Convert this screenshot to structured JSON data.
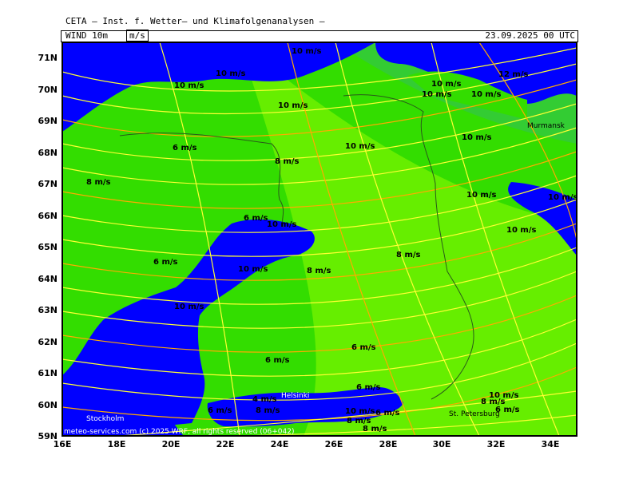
{
  "header": {
    "title": "CETA — Inst. f. Wetter— und Klimafolgenanalysen —",
    "parameter": "WIND  10m",
    "unit": "m/s",
    "valid_time": "23.09.2025  00 UTC"
  },
  "map": {
    "lat_ticks": [
      "71N",
      "70N",
      "69N",
      "68N",
      "67N",
      "66N",
      "65N",
      "64N",
      "63N",
      "62N",
      "61N",
      "60N",
      "59N"
    ],
    "lon_ticks": [
      "16E",
      "18E",
      "20E",
      "22E",
      "24E",
      "26E",
      "28E",
      "30E",
      "32E",
      "34E"
    ],
    "colors": {
      "sea": "#0000ff",
      "wind_6_8": "#00dd00",
      "wind_8_10": "#55ee00",
      "wind_10_plus": "#33cc33",
      "stream_light": "#ffff33",
      "stream_orange": "#ffaa00"
    },
    "wind_labels": [
      "10 m/s",
      "10 m/s",
      "10 m/s",
      "10 m/s",
      "10 m/s",
      "6 m/s",
      "8 m/s",
      "10 m/s",
      "10 m/s",
      "8 m/s",
      "10 m/s",
      "10 m/s",
      "10 m/s",
      "10 m/s",
      "6 m/s",
      "8 m/s",
      "6 m/s",
      "10 m/s",
      "8 m/s",
      "10 m/s",
      "6 m/s",
      "6 m/s",
      "6 m/s",
      "4 m/s",
      "8 m/s",
      "6 m/s",
      "8 m/s",
      "10 m/s",
      "8 m/s",
      "6 m/s",
      "10 m/s",
      "8 m/s",
      "6 m/s",
      "12 m/s",
      "10 m/s",
      "10 m/s"
    ],
    "cities": [
      "Murmansk",
      "Helsinki",
      "Stockholm",
      "St. Petersburg"
    ],
    "copyright": "meteo-services.com (c) 2025 WRF, all rights reserved (06+042)"
  }
}
